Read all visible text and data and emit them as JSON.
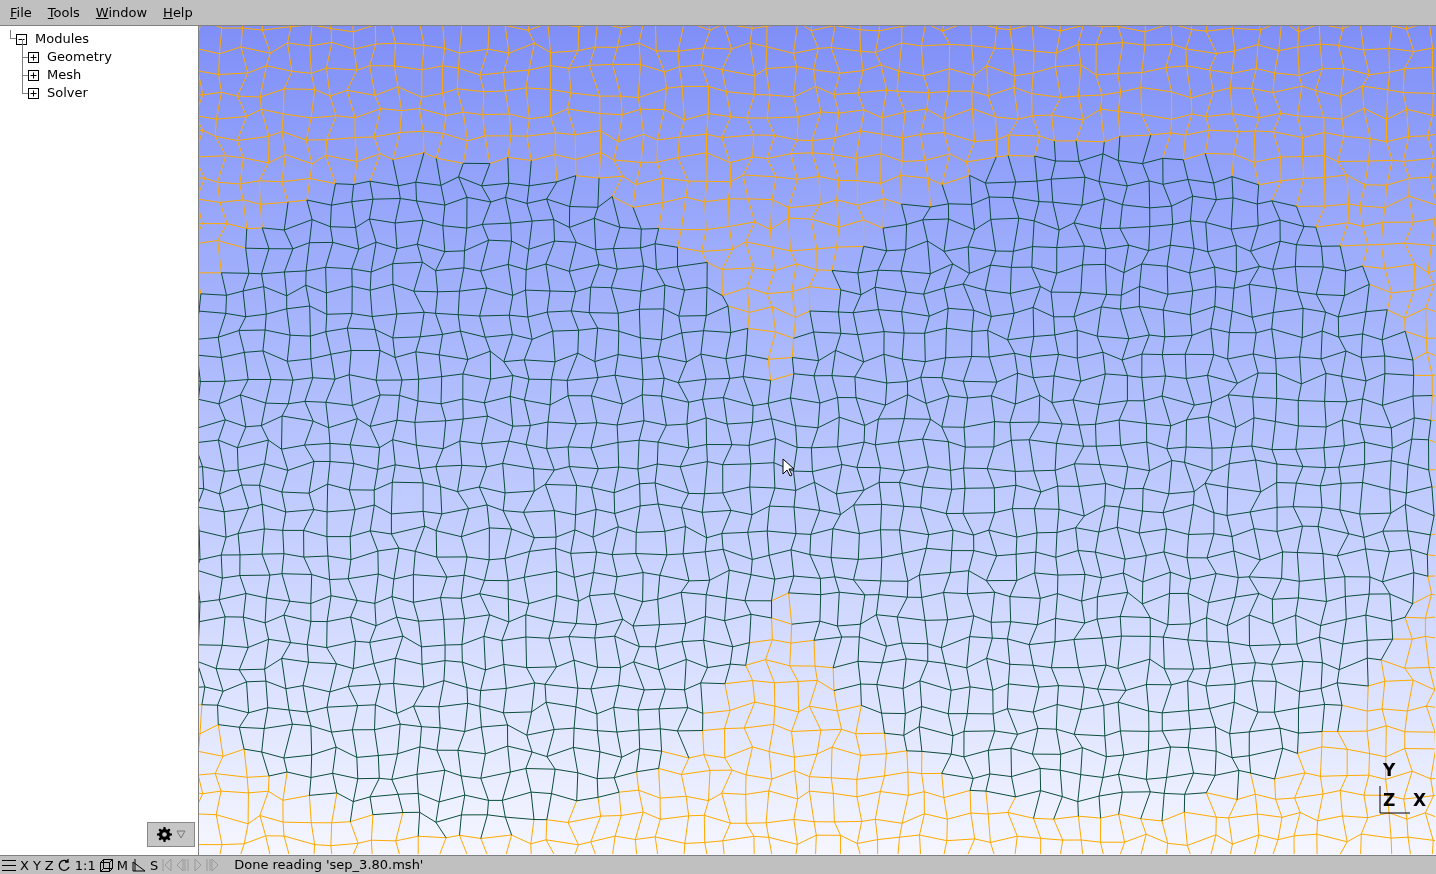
{
  "menu": [
    {
      "label": "File"
    },
    {
      "label": "Tools"
    },
    {
      "label": "Window"
    },
    {
      "label": "Help"
    }
  ],
  "tree": {
    "label": "Modules",
    "expanded": true,
    "children": [
      {
        "label": "Geometry",
        "expanded": false
      },
      {
        "label": "Mesh",
        "expanded": false
      },
      {
        "label": "Solver",
        "expanded": false
      }
    ]
  },
  "axes": {
    "y": "Y",
    "z": "Z",
    "x": "X"
  },
  "status_bar": {
    "buttons": [
      "X",
      "Y",
      "Z",
      "1:1",
      "M",
      "S"
    ],
    "animation_disabled": true,
    "message": "Done reading 'sep_3.80.msh'"
  }
}
